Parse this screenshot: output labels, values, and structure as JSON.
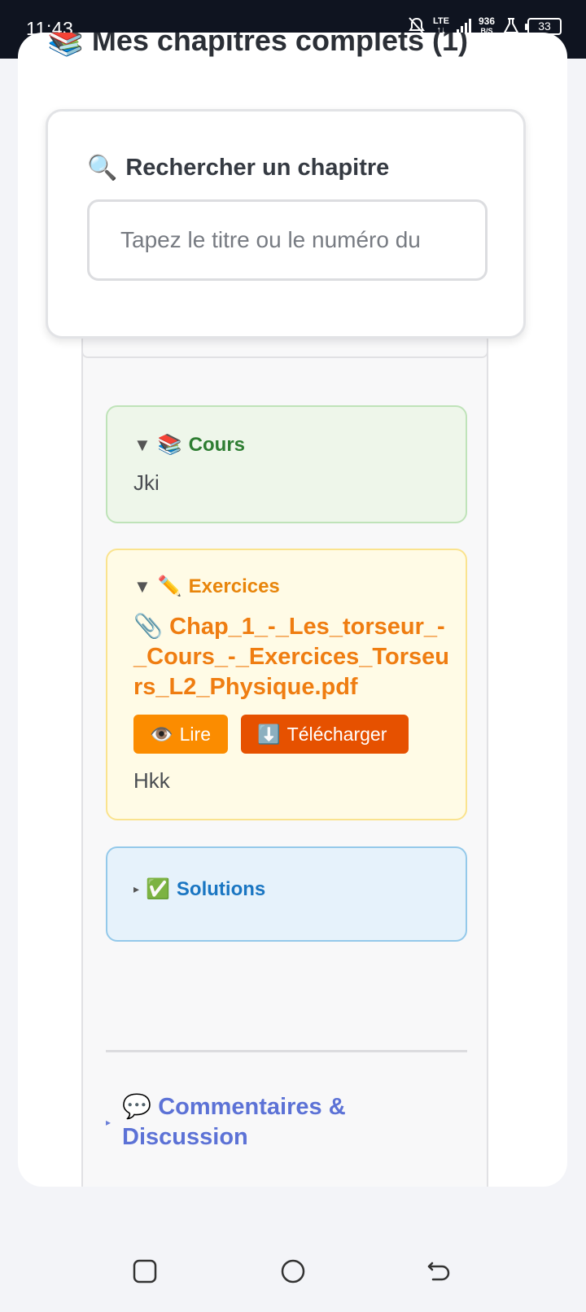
{
  "status_bar": {
    "time": "11:43",
    "network": "LTE",
    "speed_value": "936",
    "speed_unit": "B/S",
    "battery": "33"
  },
  "page": {
    "title": "📚 Mes chapitres complets (1)"
  },
  "search": {
    "icon": "🔍",
    "title": "Rechercher un chapitre",
    "placeholder": "Tapez le titre ou le numéro du"
  },
  "sections": {
    "cours": {
      "toggle": "▼",
      "icon": "📚",
      "title": "Cours",
      "text": "Jki"
    },
    "exercices": {
      "toggle": "▼",
      "icon": "✏️",
      "title": "Exercices",
      "file_icon": "📎",
      "file_name": "Chap_1_-_Les_torseur_-_Cours_-_Exercices_Torseurs_L2_Physique.pdf",
      "read_icon": "👁️",
      "read_label": "Lire",
      "download_icon": "⬇️",
      "download_label": "Télécharger",
      "text": "Hkk"
    },
    "solutions": {
      "toggle": "▸",
      "icon": "✅",
      "title": "Solutions"
    }
  },
  "comments": {
    "toggle": "▸",
    "icon": "💬",
    "title": "Commentaires & Discussion"
  },
  "colors": {
    "status_bar_bg": "#0f1420",
    "cours_accent": "#2e7d32",
    "exercices_accent": "#ef7d11",
    "solutions_accent": "#1a76c2",
    "comments_accent": "#5c72d6",
    "read_button": "#fb8c00",
    "download_button": "#e65100"
  }
}
